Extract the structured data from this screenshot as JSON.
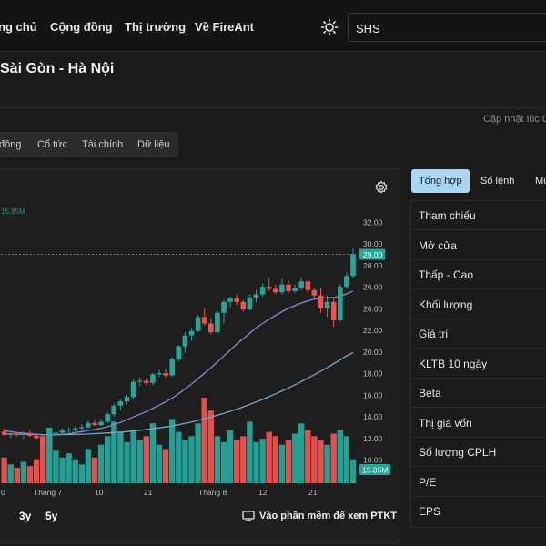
{
  "nav": {
    "items": [
      "ng chủ",
      "Cộng đồng",
      "Thị trường",
      "Về FireAnt"
    ]
  },
  "search": {
    "value": "SHS",
    "icon": "search"
  },
  "company": {
    "name": "Sài Gòn - Hà Nội"
  },
  "updated": {
    "text": "Cập nhật lúc 0"
  },
  "subtabs": [
    "đông",
    "Cổ tức",
    "Tài chính",
    "Dữ liệu"
  ],
  "chart_data": {
    "type": "candlestick",
    "x_labels": [
      "0",
      "Tháng 7",
      "10",
      "21",
      "Tháng 8",
      "12",
      "21"
    ],
    "y_ticks": [
      "32.00",
      "30.00",
      "28.00",
      "26.00",
      "24.00",
      "22.00",
      "20.00",
      "18.00",
      "16.00",
      "14.00",
      "12.00",
      "10.00"
    ],
    "price_tag": "29.00",
    "volume_tag": "15.85M",
    "volume_max_label": "15,85M",
    "ylim": [
      9.0,
      32.5
    ],
    "candles": [
      [
        12.6,
        12.9,
        12.2,
        12.3
      ],
      [
        12.3,
        12.6,
        12.0,
        12.4
      ],
      [
        12.4,
        12.5,
        12.1,
        12.3
      ],
      [
        12.3,
        12.6,
        11.9,
        12.4
      ],
      [
        12.4,
        12.7,
        12.1,
        12.2
      ],
      [
        12.2,
        12.4,
        11.9,
        12.0
      ],
      [
        12.0,
        12.2,
        11.3,
        11.5
      ],
      [
        11.5,
        12.5,
        11.4,
        12.3
      ],
      [
        12.3,
        12.6,
        12.1,
        12.5
      ],
      [
        12.5,
        12.9,
        12.3,
        12.7
      ],
      [
        12.7,
        13.0,
        12.4,
        12.8
      ],
      [
        12.8,
        13.1,
        12.5,
        12.9
      ],
      [
        12.9,
        13.3,
        12.7,
        13.0
      ],
      [
        13.0,
        13.6,
        12.9,
        13.4
      ],
      [
        13.4,
        13.7,
        13.1,
        13.2
      ],
      [
        13.2,
        13.8,
        13.1,
        13.5
      ],
      [
        13.5,
        14.4,
        13.4,
        14.2
      ],
      [
        14.2,
        15.2,
        14.0,
        15.0
      ],
      [
        15.0,
        15.6,
        14.6,
        15.4
      ],
      [
        15.4,
        16.0,
        15.1,
        15.8
      ],
      [
        15.8,
        17.4,
        15.6,
        17.2
      ],
      [
        17.2,
        17.6,
        16.8,
        17.3
      ],
      [
        17.3,
        17.6,
        16.9,
        17.1
      ],
      [
        17.1,
        18.0,
        16.9,
        17.9
      ],
      [
        17.9,
        18.3,
        17.7,
        18.0
      ],
      [
        18.0,
        18.4,
        17.6,
        17.8
      ],
      [
        17.8,
        19.5,
        17.7,
        19.3
      ],
      [
        19.3,
        20.6,
        19.1,
        20.5
      ],
      [
        20.5,
        21.8,
        19.9,
        21.5
      ],
      [
        21.5,
        22.2,
        21.0,
        21.9
      ],
      [
        21.9,
        23.4,
        21.8,
        23.2
      ],
      [
        23.2,
        24.0,
        22.4,
        22.6
      ],
      [
        22.6,
        23.1,
        21.6,
        21.8
      ],
      [
        21.8,
        23.8,
        21.7,
        23.6
      ],
      [
        23.6,
        24.8,
        22.6,
        24.6
      ],
      [
        24.6,
        25.1,
        24.1,
        24.9
      ],
      [
        24.9,
        25.3,
        24.3,
        24.6
      ],
      [
        24.6,
        24.8,
        23.7,
        23.9
      ],
      [
        23.9,
        25.3,
        23.8,
        25.0
      ],
      [
        25.0,
        25.7,
        24.6,
        25.3
      ],
      [
        25.3,
        26.3,
        25.1,
        26.0
      ],
      [
        26.0,
        26.8,
        25.6,
        25.8
      ],
      [
        25.8,
        26.2,
        25.3,
        25.5
      ],
      [
        25.5,
        26.7,
        25.3,
        26.2
      ],
      [
        26.2,
        26.6,
        25.4,
        25.6
      ],
      [
        25.6,
        26.2,
        25.4,
        25.9
      ],
      [
        25.9,
        26.9,
        25.7,
        26.5
      ],
      [
        26.5,
        26.8,
        25.4,
        25.7
      ],
      [
        25.7,
        25.9,
        24.9,
        25.2
      ],
      [
        25.2,
        25.9,
        23.6,
        24.0
      ],
      [
        24.0,
        25.2,
        23.2,
        24.6
      ],
      [
        24.6,
        24.9,
        22.3,
        22.9
      ],
      [
        22.9,
        26.2,
        22.8,
        26.0
      ],
      [
        26.0,
        27.3,
        25.8,
        27.0
      ],
      [
        27.0,
        29.6,
        26.8,
        29.0
      ]
    ],
    "ma_fast": [
      12.7,
      12.6,
      12.5,
      12.45,
      12.4,
      12.35,
      12.3,
      12.3,
      12.3,
      12.35,
      12.4,
      12.5,
      12.6,
      12.7,
      12.8,
      12.9,
      13.05,
      13.25,
      13.45,
      13.7,
      13.95,
      14.2,
      14.45,
      14.75,
      15.05,
      15.35,
      15.7,
      16.1,
      16.55,
      17.0,
      17.5,
      18.0,
      18.5,
      19.05,
      19.6,
      20.15,
      20.7,
      21.2,
      21.7,
      22.2,
      22.6,
      23.0,
      23.35,
      23.7,
      24.0,
      24.25,
      24.5,
      24.7,
      24.85,
      24.95,
      25.0,
      25.0,
      25.15,
      25.35,
      25.6
    ],
    "ma_slow": [
      12.4,
      12.38,
      12.36,
      12.35,
      12.34,
      12.33,
      12.32,
      12.31,
      12.31,
      12.32,
      12.33,
      12.34,
      12.36,
      12.38,
      12.41,
      12.44,
      12.47,
      12.51,
      12.55,
      12.6,
      12.66,
      12.72,
      12.79,
      12.86,
      12.94,
      13.03,
      13.13,
      13.24,
      13.36,
      13.49,
      13.63,
      13.78,
      13.94,
      14.11,
      14.29,
      14.48,
      14.68,
      14.89,
      15.11,
      15.34,
      15.58,
      15.83,
      16.09,
      16.36,
      16.64,
      16.93,
      17.23,
      17.54,
      17.86,
      18.19,
      18.53,
      18.88,
      19.24,
      19.61,
      19.9
    ],
    "volumes": [
      0.3,
      0.22,
      0.18,
      0.25,
      0.2,
      0.28,
      0.55,
      0.65,
      0.38,
      0.3,
      0.35,
      0.28,
      0.22,
      0.4,
      0.3,
      0.45,
      0.55,
      0.72,
      0.6,
      0.48,
      0.62,
      0.5,
      0.55,
      0.7,
      0.45,
      0.4,
      0.75,
      0.6,
      0.5,
      0.55,
      0.7,
      1.0,
      0.85,
      0.55,
      0.48,
      0.62,
      0.5,
      0.55,
      0.72,
      0.48,
      0.52,
      0.6,
      0.55,
      0.45,
      0.5,
      0.58,
      0.7,
      0.62,
      0.55,
      0.5,
      0.45,
      0.58,
      0.62,
      0.55,
      0.28
    ]
  },
  "colors": {
    "up": "#26a69a",
    "down": "#ef5350",
    "ma_fast": "#8a88d6",
    "ma_slow": "#7aa6c8",
    "ref_line": "#26a69a",
    "tab_active": "#a9d6f5"
  },
  "ranges": [
    "3y",
    "5y"
  ],
  "open_pro": {
    "label": "Vào phần mềm để xem PTKT",
    "icon": "monitor"
  },
  "right_tabs": [
    "Tổng hợp",
    "Số lệnh",
    "Mu"
  ],
  "info_labels": [
    "Tham chiếu",
    "Mở cửa",
    "Thấp - Cao",
    "Khối lượng",
    "Giá trị",
    "KLTB 10 ngày",
    "Beta",
    "Thị giá vốn",
    "Số lượng CPLH",
    "P/E",
    "EPS"
  ]
}
